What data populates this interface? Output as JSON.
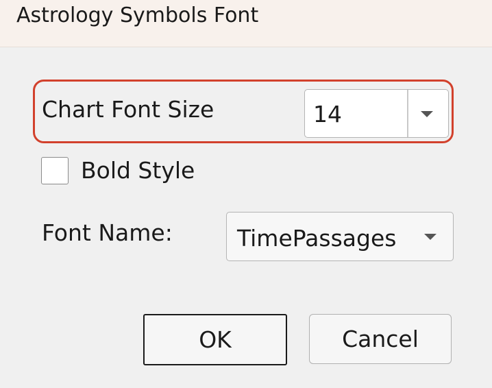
{
  "window": {
    "title": "Astrology Symbols Font"
  },
  "chart_font_size": {
    "label": "Chart Font Size",
    "value": "14",
    "highlight_color": "#d2412c"
  },
  "bold_style": {
    "label": "Bold Style",
    "checked": false
  },
  "font_name": {
    "label": "Font Name:",
    "value": "TimePassages"
  },
  "buttons": {
    "ok_label": "OK",
    "cancel_label": "Cancel"
  },
  "icons": {
    "dropdown": "chevron-down-icon"
  }
}
